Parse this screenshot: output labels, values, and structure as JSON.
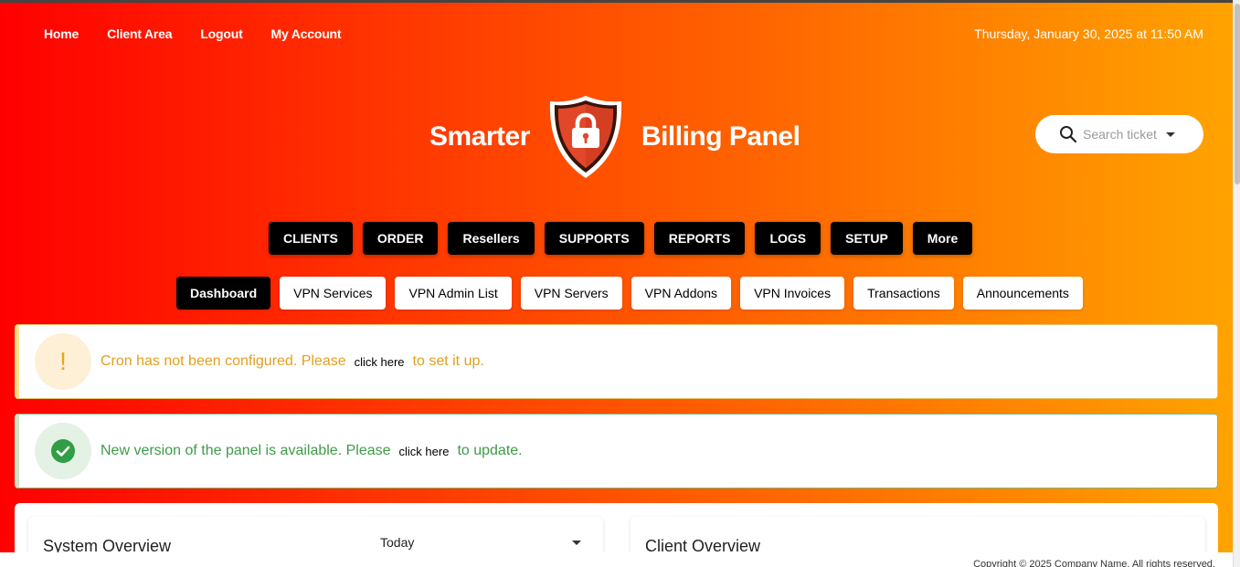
{
  "topnav": {
    "items": [
      "Home",
      "Client Area",
      "Logout",
      "My Account"
    ]
  },
  "datetime": "Thursday, January 30, 2025 at 11:50 AM",
  "brand": {
    "left": "Smarter",
    "right": "Billing Panel",
    "logo_icon": "padlock-shield-icon"
  },
  "search": {
    "placeholder": "Search ticket"
  },
  "main_menu": [
    "CLIENTS",
    "ORDER",
    "Resellers",
    "SUPPORTS",
    "REPORTS",
    "LOGS",
    "SETUP",
    "More"
  ],
  "sub_menu": {
    "active": "Dashboard",
    "items": [
      "Dashboard",
      "VPN Services",
      "VPN Admin List",
      "VPN Servers",
      "VPN Addons",
      "VPN Invoices",
      "Transactions",
      "Announcements"
    ]
  },
  "alerts": {
    "cron": {
      "before": "Cron has not been configured. Please",
      "link": "click here",
      "after": "to set it up.",
      "icon": "!"
    },
    "update": {
      "before": "New version of the panel is available. Please",
      "link": "click here",
      "after": "to update."
    }
  },
  "cards": {
    "system": {
      "title": "System Overview",
      "period": "Today"
    },
    "client": {
      "title": "Client Overview"
    }
  },
  "footer": "Copyright © 2025 Company Name. All rights reserved.",
  "colors": {
    "gradient_start": "#ff0000",
    "gradient_end": "#ffa300",
    "warn": "#e0a020",
    "success": "#3e9b47"
  }
}
